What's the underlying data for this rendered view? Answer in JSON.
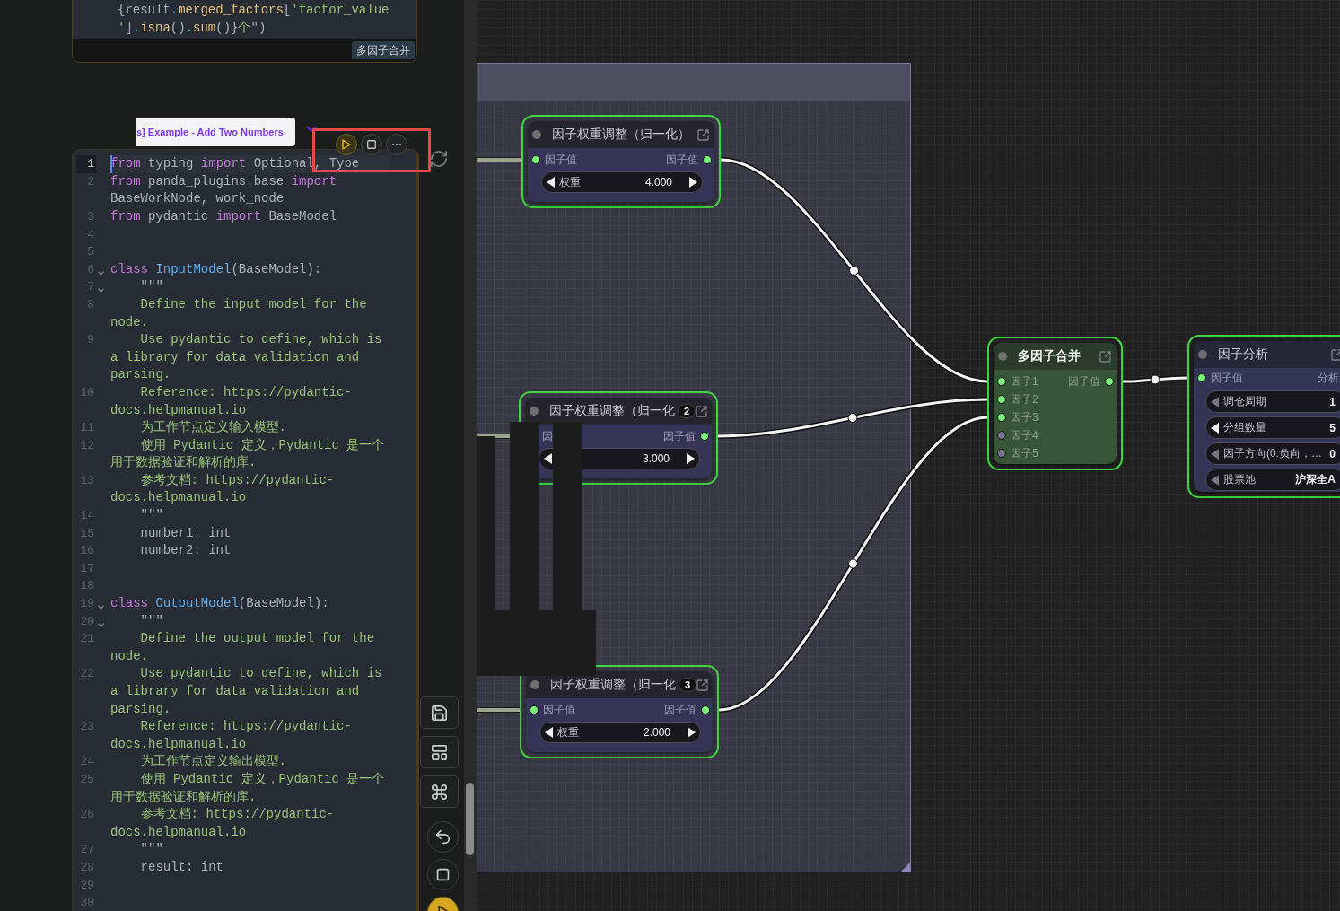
{
  "editor": {
    "output_card": {
      "lines": [
        {
          "tokens": [
            {
              "kind": "plain",
              "text": "{result"
            },
            {
              "kind": "op",
              "text": "."
            },
            {
              "kind": "attr",
              "text": "merged_factors"
            },
            {
              "kind": "plain",
              "text": "["
            },
            {
              "kind": "string",
              "text": "'factor_value"
            }
          ]
        },
        {
          "tokens": [
            {
              "kind": "string",
              "text": "'"
            },
            {
              "kind": "plain",
              "text": "]"
            },
            {
              "kind": "op",
              "text": "."
            },
            {
              "kind": "attr",
              "text": "isna"
            },
            {
              "kind": "plain",
              "text": "()"
            },
            {
              "kind": "op",
              "text": "."
            },
            {
              "kind": "attr",
              "text": "sum"
            },
            {
              "kind": "plain",
              "text": "()}"
            },
            {
              "kind": "string",
              "text": "个"
            },
            {
              "kind": "plain",
              "text": "\")"
            }
          ]
        }
      ],
      "tag": "多因子合并"
    },
    "title_tab": "s] Example - Add Two Numbers",
    "code_lines": [
      {
        "number": "1",
        "selected": true,
        "fold": false,
        "tokens": [
          {
            "kind": "keyword",
            "text": "from"
          },
          {
            "kind": "plain",
            "text": " typing "
          },
          {
            "kind": "keyword",
            "text": "import"
          },
          {
            "kind": "plain",
            "text": " Optional, Type"
          }
        ]
      },
      {
        "number": "2",
        "selected": false,
        "fold": false,
        "tokens": [
          {
            "kind": "keyword",
            "text": "from"
          },
          {
            "kind": "plain",
            "text": " panda_plugins"
          },
          {
            "kind": "op",
            "text": "."
          },
          {
            "kind": "plain",
            "text": "base "
          },
          {
            "kind": "keyword",
            "text": "import"
          },
          {
            "kind": "plain",
            "text": " BaseWorkNode, work_node"
          }
        ]
      },
      {
        "number": "3",
        "selected": false,
        "fold": false,
        "tokens": [
          {
            "kind": "keyword",
            "text": "from"
          },
          {
            "kind": "plain",
            "text": " pydantic "
          },
          {
            "kind": "keyword",
            "text": "import"
          },
          {
            "kind": "plain",
            "text": " BaseModel"
          }
        ]
      },
      {
        "number": "4",
        "selected": false,
        "fold": false
      },
      {
        "number": "5",
        "selected": false,
        "fold": false
      },
      {
        "number": "6",
        "selected": false,
        "fold": true,
        "tokens": [
          {
            "kind": "keyword",
            "text": "class"
          },
          {
            "kind": "name",
            "text": " InputModel"
          },
          {
            "kind": "plain",
            "text": "(BaseModel):"
          }
        ]
      },
      {
        "number": "7",
        "selected": false,
        "fold": true,
        "tokens": [
          {
            "kind": "plain",
            "text": "    \"\"\""
          }
        ]
      },
      {
        "number": "8",
        "selected": false,
        "fold": false,
        "tokens": [
          {
            "kind": "string",
            "text": "    Define the input model for the node."
          }
        ]
      },
      {
        "number": "9",
        "selected": false,
        "fold": false,
        "tokens": [
          {
            "kind": "string",
            "text": "    Use pydantic to define, which is a library for data validation and parsing."
          }
        ]
      },
      {
        "number": "10",
        "selected": false,
        "fold": false,
        "tokens": [
          {
            "kind": "string",
            "text": "    Reference: https://pydantic-docs.helpmanual.io"
          }
        ]
      },
      {
        "number": "11",
        "selected": false,
        "fold": false,
        "tokens": [
          {
            "kind": "string",
            "text": "    为工作节点定义输入模型."
          }
        ]
      },
      {
        "number": "12",
        "selected": false,
        "fold": false,
        "tokens": [
          {
            "kind": "string",
            "text": "    使用 Pydantic 定义，Pydantic 是一个用于数据验证和解析的库."
          }
        ]
      },
      {
        "number": "13",
        "selected": false,
        "fold": false,
        "tokens": [
          {
            "kind": "string",
            "text": "    参考文档: https://pydantic-docs.helpmanual.io"
          }
        ]
      },
      {
        "number": "14",
        "selected": false,
        "fold": false,
        "tokens": [
          {
            "kind": "plain",
            "text": "    \"\"\""
          }
        ]
      },
      {
        "number": "15",
        "selected": false,
        "fold": false,
        "tokens": [
          {
            "kind": "plain",
            "text": "    number1: int"
          }
        ]
      },
      {
        "number": "16",
        "selected": false,
        "fold": false,
        "tokens": [
          {
            "kind": "plain",
            "text": "    number2: int"
          }
        ]
      },
      {
        "number": "17",
        "selected": false,
        "fold": false
      },
      {
        "number": "18",
        "selected": false,
        "fold": false
      },
      {
        "number": "19",
        "selected": false,
        "fold": true,
        "tokens": [
          {
            "kind": "keyword",
            "text": "class"
          },
          {
            "kind": "name",
            "text": " OutputModel"
          },
          {
            "kind": "plain",
            "text": "(BaseModel):"
          }
        ]
      },
      {
        "number": "20",
        "selected": false,
        "fold": true,
        "tokens": [
          {
            "kind": "plain",
            "text": "    \"\"\""
          }
        ]
      },
      {
        "number": "21",
        "selected": false,
        "fold": false,
        "tokens": [
          {
            "kind": "string",
            "text": "    Define the output model for the node."
          }
        ]
      },
      {
        "number": "22",
        "selected": false,
        "fold": false,
        "tokens": [
          {
            "kind": "string",
            "text": "    Use pydantic to define, which is a library for data validation and parsing."
          }
        ]
      },
      {
        "number": "23",
        "selected": false,
        "fold": false,
        "tokens": [
          {
            "kind": "string",
            "text": "    Reference: https://pydantic-docs.helpmanual.io"
          }
        ]
      },
      {
        "number": "24",
        "selected": false,
        "fold": false,
        "tokens": [
          {
            "kind": "string",
            "text": "    为工作节点定义输出模型."
          }
        ]
      },
      {
        "number": "25",
        "selected": false,
        "fold": false,
        "tokens": [
          {
            "kind": "string",
            "text": "    使用 Pydantic 定义，Pydantic 是一个用于数据验证和解析的库."
          }
        ]
      },
      {
        "number": "26",
        "selected": false,
        "fold": false,
        "tokens": [
          {
            "kind": "string",
            "text": "    参考文档: https://pydantic-docs.helpmanual.io"
          }
        ]
      },
      {
        "number": "27",
        "selected": false,
        "fold": false,
        "tokens": [
          {
            "kind": "plain",
            "text": "    \"\"\""
          }
        ]
      },
      {
        "number": "28",
        "selected": false,
        "fold": false,
        "tokens": [
          {
            "kind": "plain",
            "text": "    result: int"
          }
        ]
      },
      {
        "number": "29",
        "selected": false,
        "fold": false
      },
      {
        "number": "30",
        "selected": false,
        "fold": false
      }
    ]
  },
  "canvas": {
    "nodes": [
      {
        "kind": "weight",
        "title": "因子权重调整（归一化）",
        "selected": true,
        "inputs": [
          {
            "label": "因子值",
            "connected": true
          }
        ],
        "outputs": [
          {
            "label": "因子值",
            "connected": true
          }
        ],
        "widgets": [
          {
            "label": "权重",
            "value": "4.000",
            "can_decrease": true,
            "can_increase": true
          }
        ]
      },
      {
        "kind": "weight",
        "title": "因子权重调整（归一化",
        "badge": "2",
        "selected": true,
        "inputs": [
          {
            "label": "因"
          }
        ],
        "outputs": [
          {
            "label": "因子值",
            "connected": true
          }
        ],
        "widgets": [
          {
            "value": "3.000",
            "can_decrease": true,
            "can_increase": true
          }
        ]
      },
      {
        "kind": "weight",
        "title": "因子权重调整（归一化",
        "badge": "3",
        "selected": true,
        "inputs": [
          {
            "label": "因子值",
            "connected": true
          }
        ],
        "outputs": [
          {
            "label": "因子值",
            "connected": true
          }
        ],
        "widgets": [
          {
            "label": "权重",
            "value": "2.000",
            "can_decrease": true,
            "can_increase": true
          }
        ]
      },
      {
        "kind": "merge",
        "title": "多因子合并",
        "selected": true,
        "inputs": [
          {
            "label": "因子1",
            "connected": true
          },
          {
            "label": "因子2",
            "connected": true
          },
          {
            "label": "因子3",
            "connected": true
          },
          {
            "label": "因子4",
            "connected": false
          },
          {
            "label": "因子5",
            "connected": false
          }
        ],
        "outputs": [
          {
            "label": "因子值",
            "connected": true
          }
        ]
      },
      {
        "kind": "analysis",
        "title": "因子分析",
        "selected": true,
        "inputs": [
          {
            "label": "因子值",
            "connected": true
          }
        ],
        "outputs": [
          {
            "label": "分析"
          }
        ],
        "widgets": [
          {
            "label": "调仓周期",
            "value": "1",
            "can_decrease": false
          },
          {
            "label": "分组数量",
            "value": "5",
            "can_decrease": true
          },
          {
            "label": "因子方向(0:负向，…",
            "value": "0",
            "can_decrease": false
          },
          {
            "label": "股票池",
            "value": "沪深全A",
            "can_decrease": false
          }
        ]
      }
    ]
  }
}
